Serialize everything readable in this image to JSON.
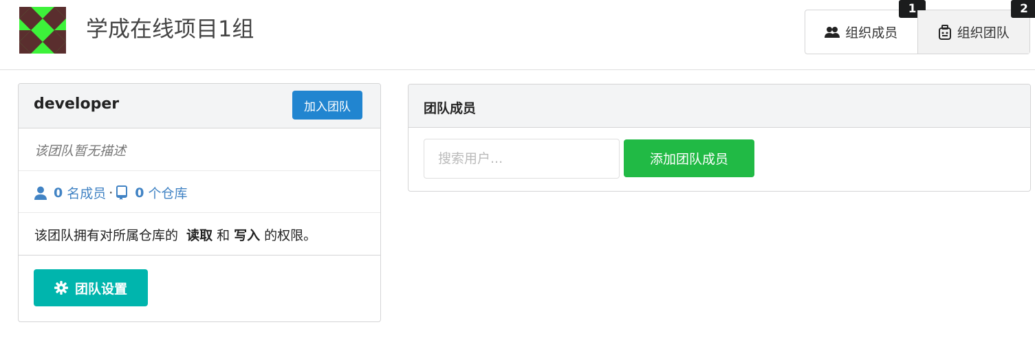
{
  "org": {
    "name": "学成在线项目1组"
  },
  "tabs": [
    {
      "label": "组织成员",
      "badge": "1",
      "icon": "users-icon"
    },
    {
      "label": "组织团队",
      "badge": "2",
      "icon": "team-icon"
    }
  ],
  "team": {
    "name": "developer",
    "join_label": "加入团队",
    "description": "该团队暂无描述",
    "member_count": "0",
    "member_label": "名成员",
    "separator": "·",
    "repo_count": "0",
    "repo_label": "个仓库",
    "perm_prefix": "该团队拥有对所属仓库的",
    "perm_read": "读取",
    "perm_and": "和",
    "perm_write": "写入",
    "perm_suffix": "的权限。",
    "settings_label": "团队设置"
  },
  "members": {
    "title": "团队成员",
    "search_placeholder": "搜索用户...",
    "add_label": "添加团队成员"
  },
  "colors": {
    "primary": "#2185d0",
    "teal": "#00b5ad",
    "green": "#21ba45",
    "link": "#4183c4",
    "logo_bg": "#3df23a",
    "logo_fg": "#5a2e2e"
  }
}
